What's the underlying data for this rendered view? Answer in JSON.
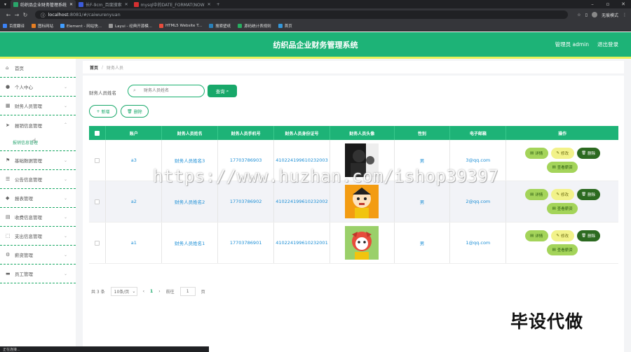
{
  "browser": {
    "tabs": [
      {
        "title": "纺织品企业财务管理系统",
        "color": "#2aa56a",
        "active": true
      },
      {
        "title": "长F-9cm_百度搜索",
        "color": "#3b5bdb",
        "active": false
      },
      {
        "title": "mysql中的DATE_FORMAT(NOW",
        "color": "#d63031",
        "active": false
      }
    ],
    "new_tab": "+",
    "url_host": "localhost",
    "url_path": ":8081/#/caiwurenyuan",
    "profile_label": "无痕模式",
    "bookmarks": [
      "百度翻译",
      "图标网站",
      "Element - 网站快...",
      "Layui - 经典开源模...",
      "HTML5 Website T...",
      "搜索壁纸",
      "源码统计表规则",
      "首页"
    ],
    "status_text": "正在连接..."
  },
  "header": {
    "title": "纺织品企业财务管理系统",
    "user": "管理员 admin",
    "logout": "退出登录"
  },
  "sidebar": {
    "items": [
      {
        "label": "首页",
        "icon": "home-icon",
        "glyph": "⌂",
        "chevron": false
      },
      {
        "label": "个人中心",
        "icon": "user-icon",
        "glyph": "👤",
        "chevron": true
      },
      {
        "label": "财务人员管理",
        "icon": "grid-icon",
        "glyph": "▦",
        "chevron": true
      },
      {
        "label": "报销信息管理",
        "icon": "send-icon",
        "glyph": "➤",
        "chevron": true,
        "sub": "报销信息管理"
      },
      {
        "label": "基础数据管理",
        "icon": "flag-icon",
        "glyph": "⚑",
        "chevron": true
      },
      {
        "label": "公告信息管理",
        "icon": "list-icon",
        "glyph": "☰",
        "chevron": true
      },
      {
        "label": "报表管理",
        "icon": "drop-icon",
        "glyph": "◆",
        "chevron": true
      },
      {
        "label": "收费信息管理",
        "icon": "cash-icon",
        "glyph": "▤",
        "chevron": true
      },
      {
        "label": "支出信息管理",
        "icon": "frame-icon",
        "glyph": "⬚",
        "chevron": true
      },
      {
        "label": "薪资管理",
        "icon": "gear-icon",
        "glyph": "⚙",
        "chevron": true
      },
      {
        "label": "员工管理",
        "icon": "monitor-icon",
        "glyph": "▬",
        "chevron": true
      }
    ]
  },
  "breadcrumb": {
    "home": "首页",
    "sep": "/",
    "current": "财务人员"
  },
  "search": {
    "label": "财务人员姓名",
    "placeholder": "财务人员姓名",
    "query_btn": "查询"
  },
  "actions": {
    "add": "新增",
    "delete": "删除"
  },
  "table": {
    "headers": [
      "账户",
      "财务人员姓名",
      "财务人员手机号",
      "财务人员身份证号",
      "财务人员头像",
      "性别",
      "电子邮箱",
      "操作"
    ],
    "rows": [
      {
        "account": "a3",
        "name": "财务人员姓名3",
        "phone": "17703786903",
        "id_card": "410224199610232003",
        "gender": "男",
        "email": "3@qq.com"
      },
      {
        "account": "a2",
        "name": "财务人员姓名2",
        "phone": "17703786902",
        "id_card": "410224199610232002",
        "gender": "男",
        "email": "2@qq.com"
      },
      {
        "account": "a1",
        "name": "财务人员姓名1",
        "phone": "17703786901",
        "id_card": "410224199610232001",
        "gender": "男",
        "email": "1@qq.com"
      }
    ],
    "ops": {
      "detail": "详情",
      "edit": "修改",
      "delete": "删除",
      "salary": "查看薪资"
    }
  },
  "pagination": {
    "total": "共 3 条",
    "page_size": "10条/页",
    "prev": "‹",
    "page": "1",
    "next": "›",
    "goto_label": "前往",
    "goto_value": "1",
    "goto_suffix": "页"
  },
  "overlay": {
    "watermark": "https://www.huzhan.com/ishop39397",
    "stamp": "毕设代做"
  },
  "colors": {
    "primary": "#1db377",
    "accent_bar": "#e8f05a",
    "dark_green": "#2c6a20"
  }
}
